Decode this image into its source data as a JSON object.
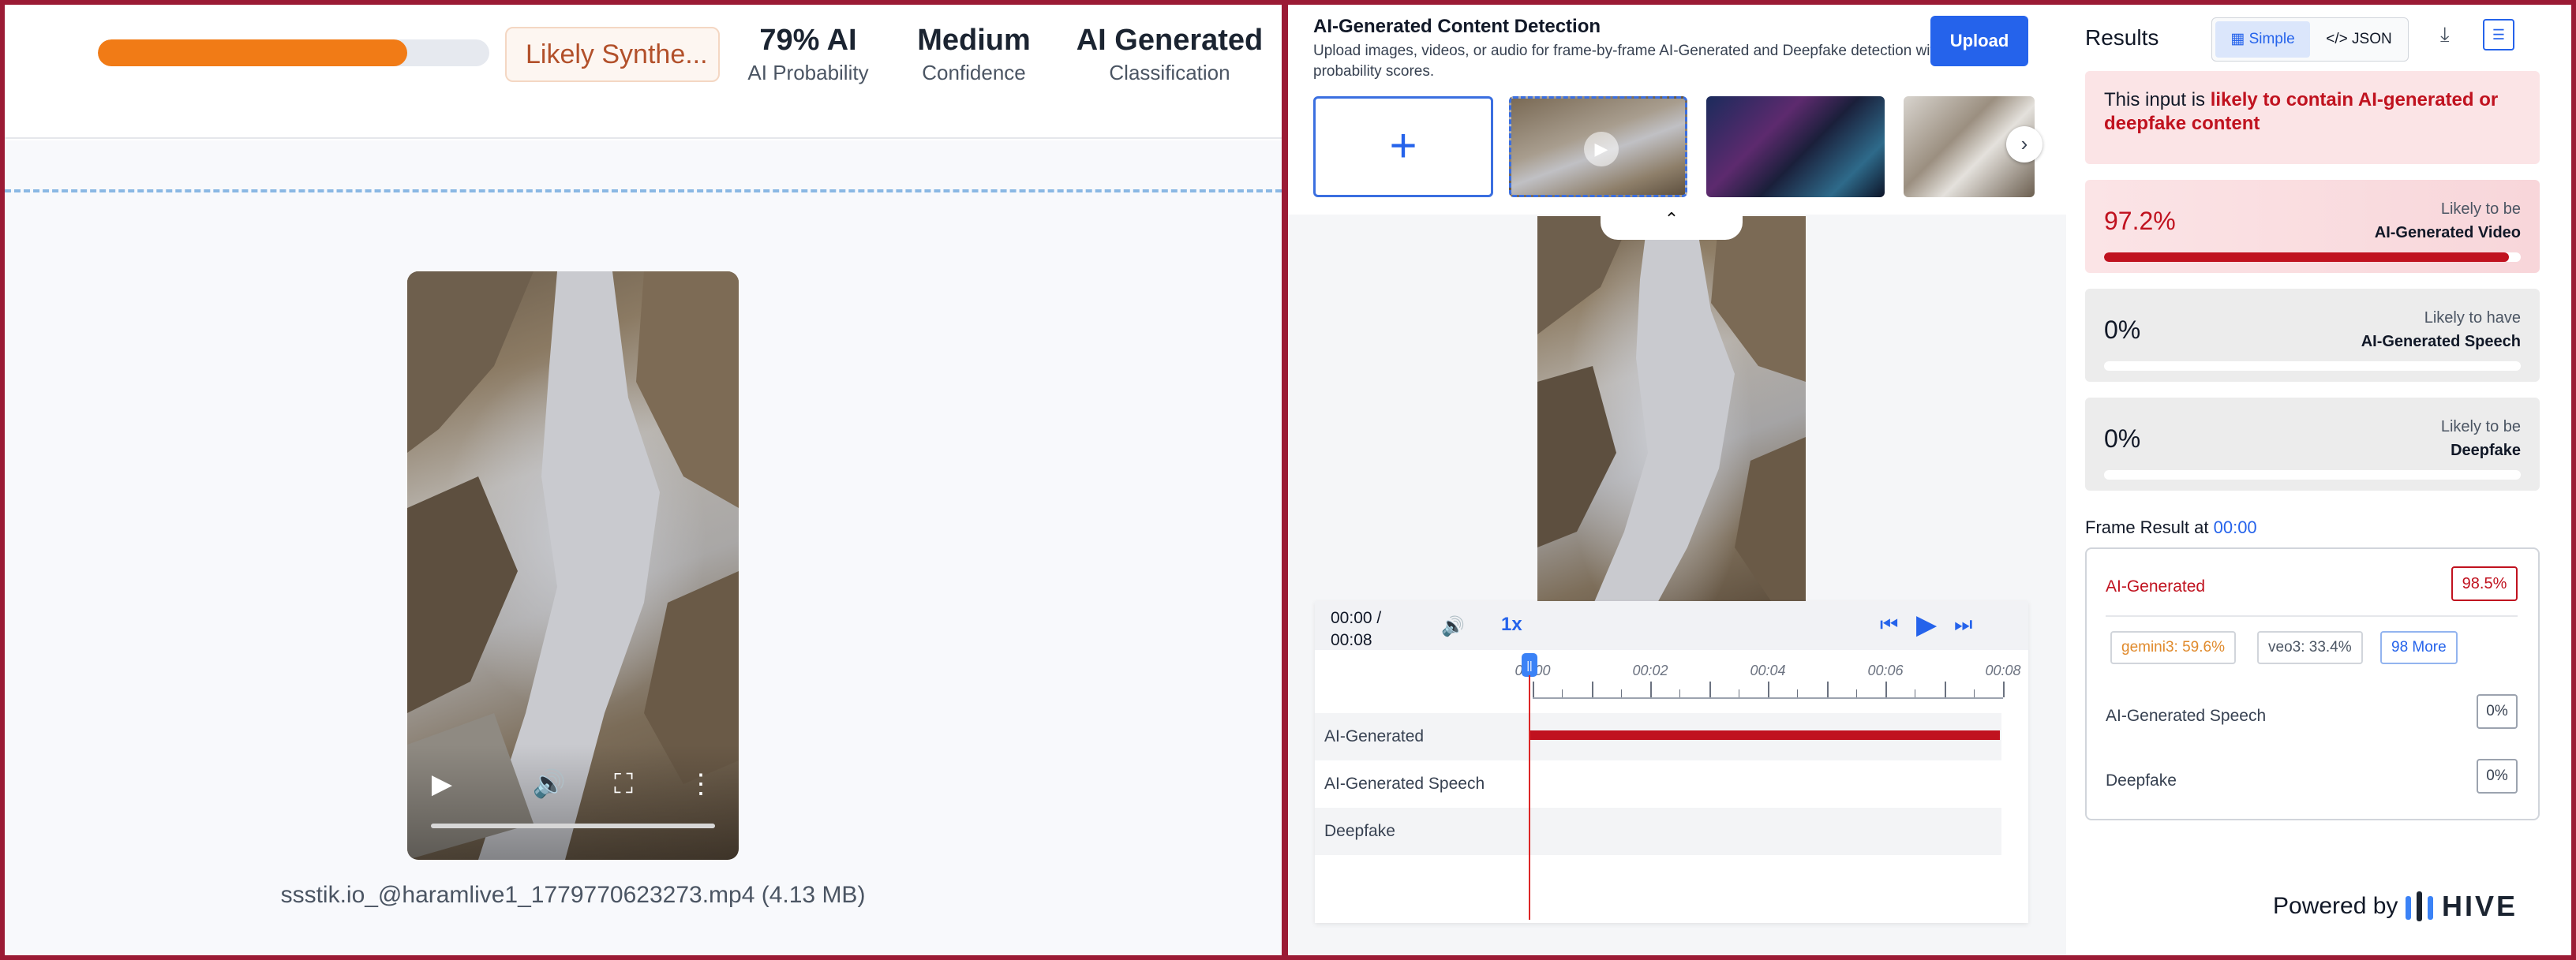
{
  "summary": {
    "progress_fraction": 0.79,
    "likely_label": "Likely Synthe...",
    "stats": [
      {
        "value": "79% AI",
        "label": "AI Probability"
      },
      {
        "value": "Medium",
        "label": "Confidence"
      },
      {
        "value": "AI Generated",
        "label": "Classification"
      }
    ]
  },
  "left_video": {
    "file_label": "ssstik.io_@haramlive1_1779770623273.mp4 (4.13 MB)"
  },
  "detector": {
    "title": "AI-Generated Content Detection",
    "subtitle": "Upload images, videos, or audio for frame-by-frame AI-Generated and Deepfake detection with probability scores.",
    "upload_label": "Upload",
    "add_glyph": "+",
    "timeline": {
      "time": "00:00 /\n00:08",
      "speed": "1x",
      "ticks": [
        "00:00",
        "00:02",
        "00:04",
        "00:06",
        "00:08"
      ],
      "scrubber_glyph": "||",
      "tracks": [
        "AI-Generated",
        "AI-Generated Speech",
        "Deepfake"
      ],
      "ai_generated_fraction": 1.0
    }
  },
  "results": {
    "title": "Results",
    "toggle_simple": "Simple",
    "toggle_json": "</> JSON",
    "verdict_prefix": "This input is ",
    "verdict_highlight": "likely to contain AI-generated or deepfake content",
    "cards": [
      {
        "pct": "97.2%",
        "line1": "Likely to be",
        "line2": "AI-Generated Video",
        "fraction": 0.972
      },
      {
        "pct": "0%",
        "line1": "Likely to have",
        "line2": "AI-Generated Speech",
        "fraction": 0
      },
      {
        "pct": "0%",
        "line1": "Likely to be",
        "line2": "Deepfake",
        "fraction": 0
      }
    ],
    "frame_result_label": "Frame Result at ",
    "frame_result_time": "00:00",
    "frame": {
      "ai_generated_label": "AI-Generated",
      "ai_generated_value": "98.5%",
      "chips": [
        "gemini3: 59.6%",
        "veo3: 33.4%",
        "98 More"
      ],
      "speech_label": "AI-Generated Speech",
      "speech_value": "0%",
      "deepfake_label": "Deepfake",
      "deepfake_value": "0%"
    },
    "powered_by": "Powered by",
    "brand": "HIVE"
  },
  "colors": {
    "frame": "#9b1b35",
    "accent": "#2563eb",
    "danger": "#c0121f",
    "progress": "#f17b16"
  }
}
